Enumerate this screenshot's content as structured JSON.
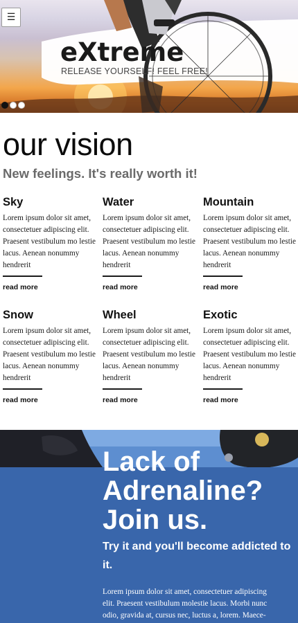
{
  "header": {
    "menu_icon": "hamburger-icon",
    "brand": "eXtreme",
    "tagline": "RELEASE YOURSELF! FEEL FREE!",
    "slider_dots": 3,
    "active_dot": 1
  },
  "vision": {
    "title": "our vision",
    "subtitle": "New feelings. It's really worth it!",
    "items": [
      {
        "title": "Sky",
        "text": "Lorem ipsum dolor sit amet, consectetuer adipiscing elit. Praesent vestibulum mo lestie lacus. Aenean nonummy hendrerit",
        "link": "read more"
      },
      {
        "title": "Water",
        "text": "Lorem ipsum dolor sit amet, consectetuer adipiscing elit. Praesent vestibulum mo lestie lacus. Aenean nonummy hendrerit",
        "link": "read more"
      },
      {
        "title": "Mountain",
        "text": "Lorem ipsum dolor sit amet, consectetuer adipiscing elit. Praesent vestibulum mo lestie lacus. Aenean nonummy hendrerit",
        "link": "read more"
      },
      {
        "title": "Snow",
        "text": "Lorem ipsum dolor sit amet, consectetuer adipiscing elit. Praesent vestibulum mo lestie lacus. Aenean nonummy hendrerit",
        "link": "read more"
      },
      {
        "title": "Wheel",
        "text": "Lorem ipsum dolor sit amet, consectetuer adipiscing elit. Praesent vestibulum mo lestie lacus. Aenean nonummy hendrerit",
        "link": "read more"
      },
      {
        "title": "Exotic",
        "text": "Lorem ipsum dolor sit amet, consectetuer adipiscing elit. Praesent vestibulum mo lestie lacus. Aenean nonummy hendrerit",
        "link": "read more"
      }
    ]
  },
  "cta": {
    "headline": "Lack of Adrenaline? Join us.",
    "subhead": "Try it and you'll become addicted to it.",
    "body": "Lorem ipsum dolor sit amet, consectetuer adipiscing elit. Praesent vestibulum molestie lacus. Morbi nunc odio, gravida at, cursus nec, luctus a, lorem. Maece-"
  },
  "colors": {
    "cta_background": "#3966ab",
    "text_dark": "#111111",
    "subtitle_gray": "#6a6a6a"
  }
}
